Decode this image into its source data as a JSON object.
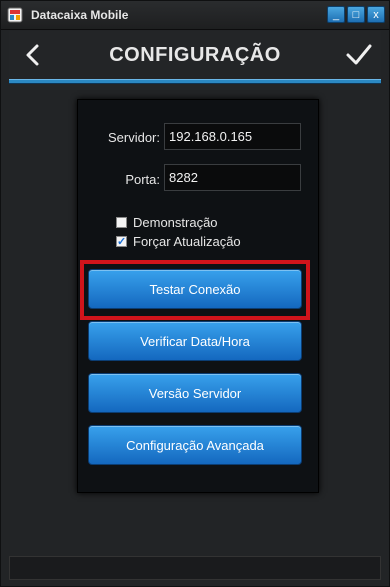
{
  "window": {
    "title": "Datacaixa Mobile",
    "controls": {
      "minimize": "_",
      "maximize": "□",
      "close": "x"
    }
  },
  "header": {
    "title": "CONFIGURAÇÃO",
    "back_icon": "chevron-left-icon",
    "confirm_icon": "checkmark-icon"
  },
  "form": {
    "server_label": "Servidor:",
    "server_value": "192.168.0.165",
    "port_label": "Porta:",
    "port_value": "8282",
    "demo_label": "Demonstração",
    "demo_checked": false,
    "force_update_label": "Forçar Atualização",
    "force_update_checked": true
  },
  "buttons": {
    "test_connection": "Testar Conexão",
    "check_datetime": "Verificar Data/Hora",
    "server_version": "Versão Servidor",
    "advanced_config": "Configuração Avançada"
  },
  "colors": {
    "accent": "#2b88c2",
    "button_top": "#38a1ec",
    "button_bottom": "#1468bf",
    "highlight": "#d0141b"
  }
}
